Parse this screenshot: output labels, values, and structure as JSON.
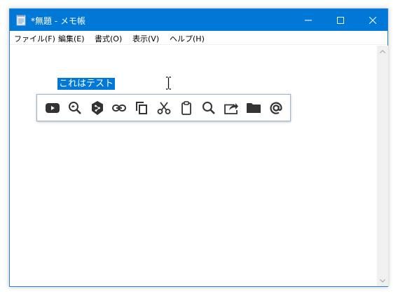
{
  "window": {
    "title": "*無題 - メモ帳",
    "accent_color": "#0078d7",
    "caption_buttons": [
      "minimize-icon",
      "maximize-icon",
      "close-icon"
    ]
  },
  "menubar": {
    "items": [
      {
        "label": "ファイル(F)"
      },
      {
        "label": "編集(E)"
      },
      {
        "label": "書式(O)"
      },
      {
        "label": "表示(V)"
      },
      {
        "label": "ヘルプ(H)"
      }
    ]
  },
  "editor": {
    "selected_text": "これはテスト",
    "selection_color": "#0078d7"
  },
  "popup_toolbar": {
    "icons": [
      "youtube-icon",
      "search-tweet-icon",
      "deepl-translate-icon",
      "link-icon",
      "copy-icon",
      "cut-icon",
      "paste-icon",
      "search-icon",
      "share-icon",
      "folder-icon",
      "email-icon"
    ]
  }
}
